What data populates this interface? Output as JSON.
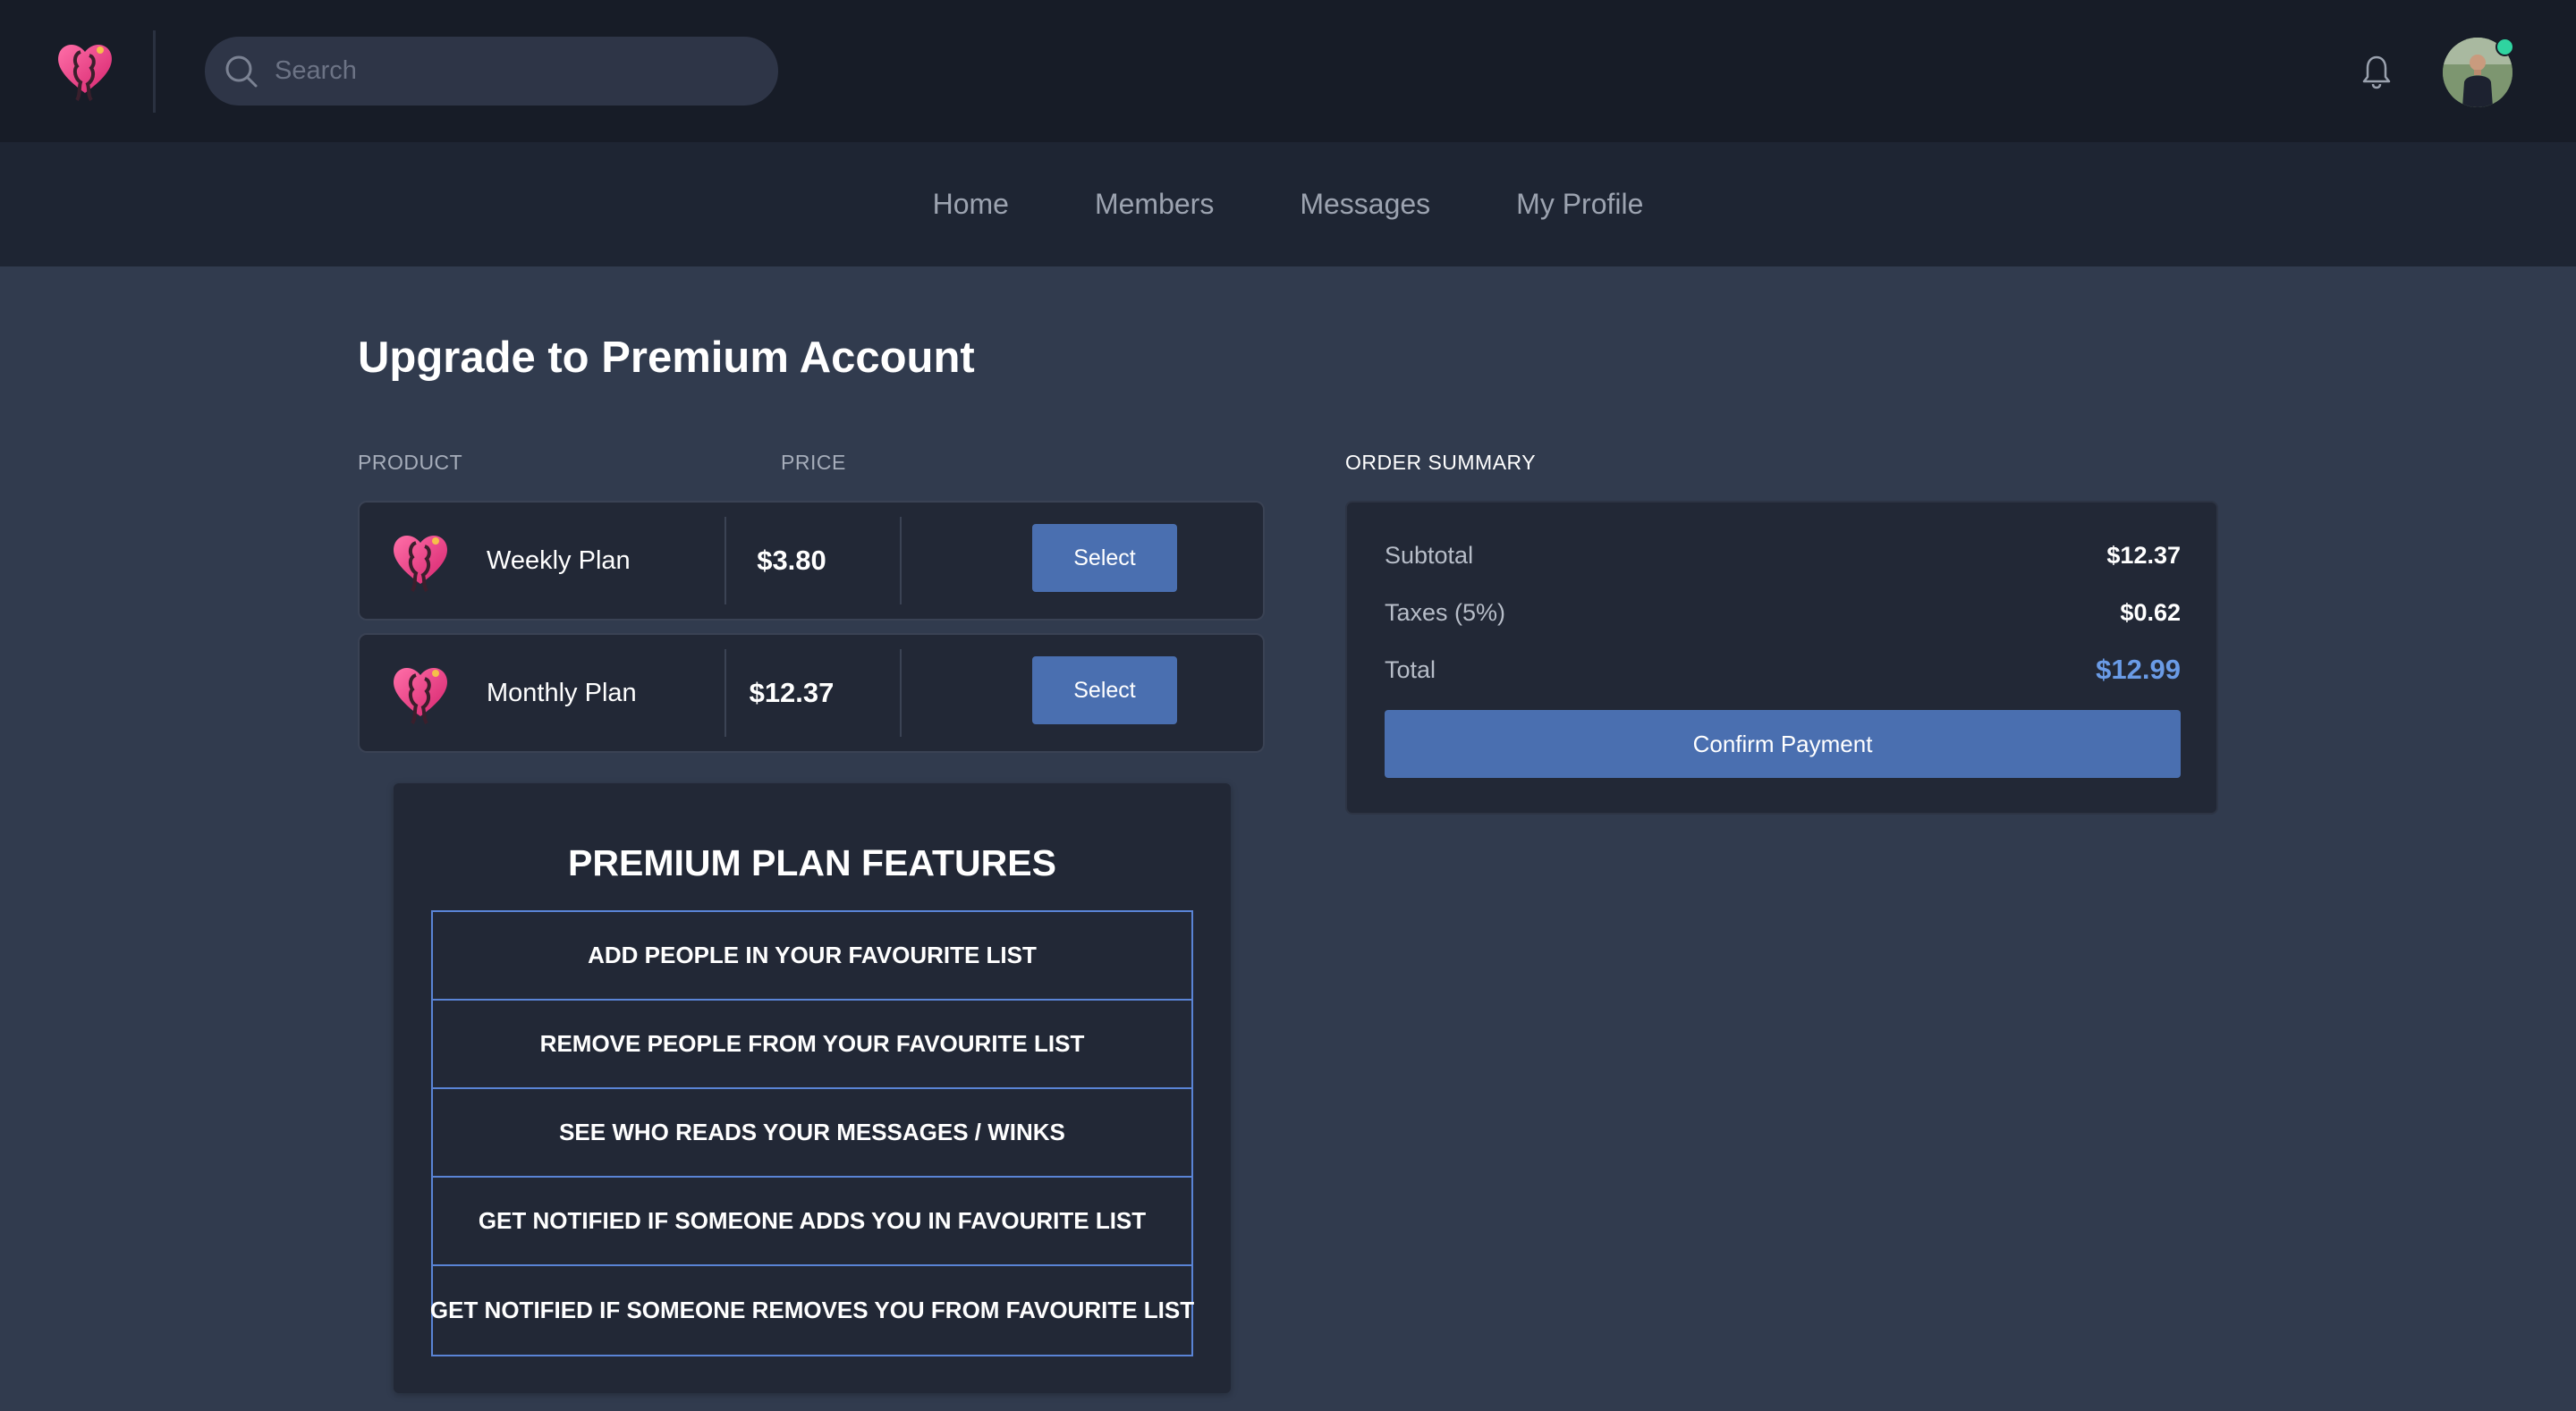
{
  "header": {
    "logo": "heart-couple-logo",
    "search": {
      "placeholder": "Search",
      "value": ""
    },
    "bell_icon": "bell-icon",
    "avatar": "user-avatar",
    "online_status_color": "#2fd4a0"
  },
  "nav": {
    "items": [
      {
        "label": "Home"
      },
      {
        "label": "Members"
      },
      {
        "label": "Messages"
      },
      {
        "label": "My Profile"
      }
    ]
  },
  "page": {
    "title": "Upgrade to Premium Account"
  },
  "products": {
    "col_product": "PRODUCT",
    "col_price": "PRICE",
    "plans": [
      {
        "name": "Weekly Plan",
        "price": "$3.80",
        "button": "Select"
      },
      {
        "name": "Monthly Plan",
        "price": "$12.37",
        "button": "Select"
      }
    ]
  },
  "features": {
    "title": "PREMIUM PLAN FEATURES",
    "items": [
      "ADD PEOPLE IN YOUR FAVOURITE LIST",
      "REMOVE PEOPLE FROM YOUR FAVOURITE LIST",
      "SEE WHO READS YOUR MESSAGES / WINKS",
      "GET NOTIFIED IF SOMEONE ADDS YOU IN FAVOURITE LIST",
      "GET NOTIFIED IF SOMEONE REMOVES YOU FROM FAVOURITE LIST"
    ]
  },
  "summary": {
    "title": "ORDER SUMMARY",
    "subtotal_label": "Subtotal",
    "subtotal_value": "$12.37",
    "taxes_label": "Taxes (5%)",
    "taxes_value": "$0.62",
    "total_label": "Total",
    "total_value": "$12.99",
    "confirm_button": "Confirm Payment"
  },
  "colors": {
    "accent": "#4a6fb0",
    "total_highlight": "#6a9be6",
    "feature_border": "#5a84d6"
  }
}
